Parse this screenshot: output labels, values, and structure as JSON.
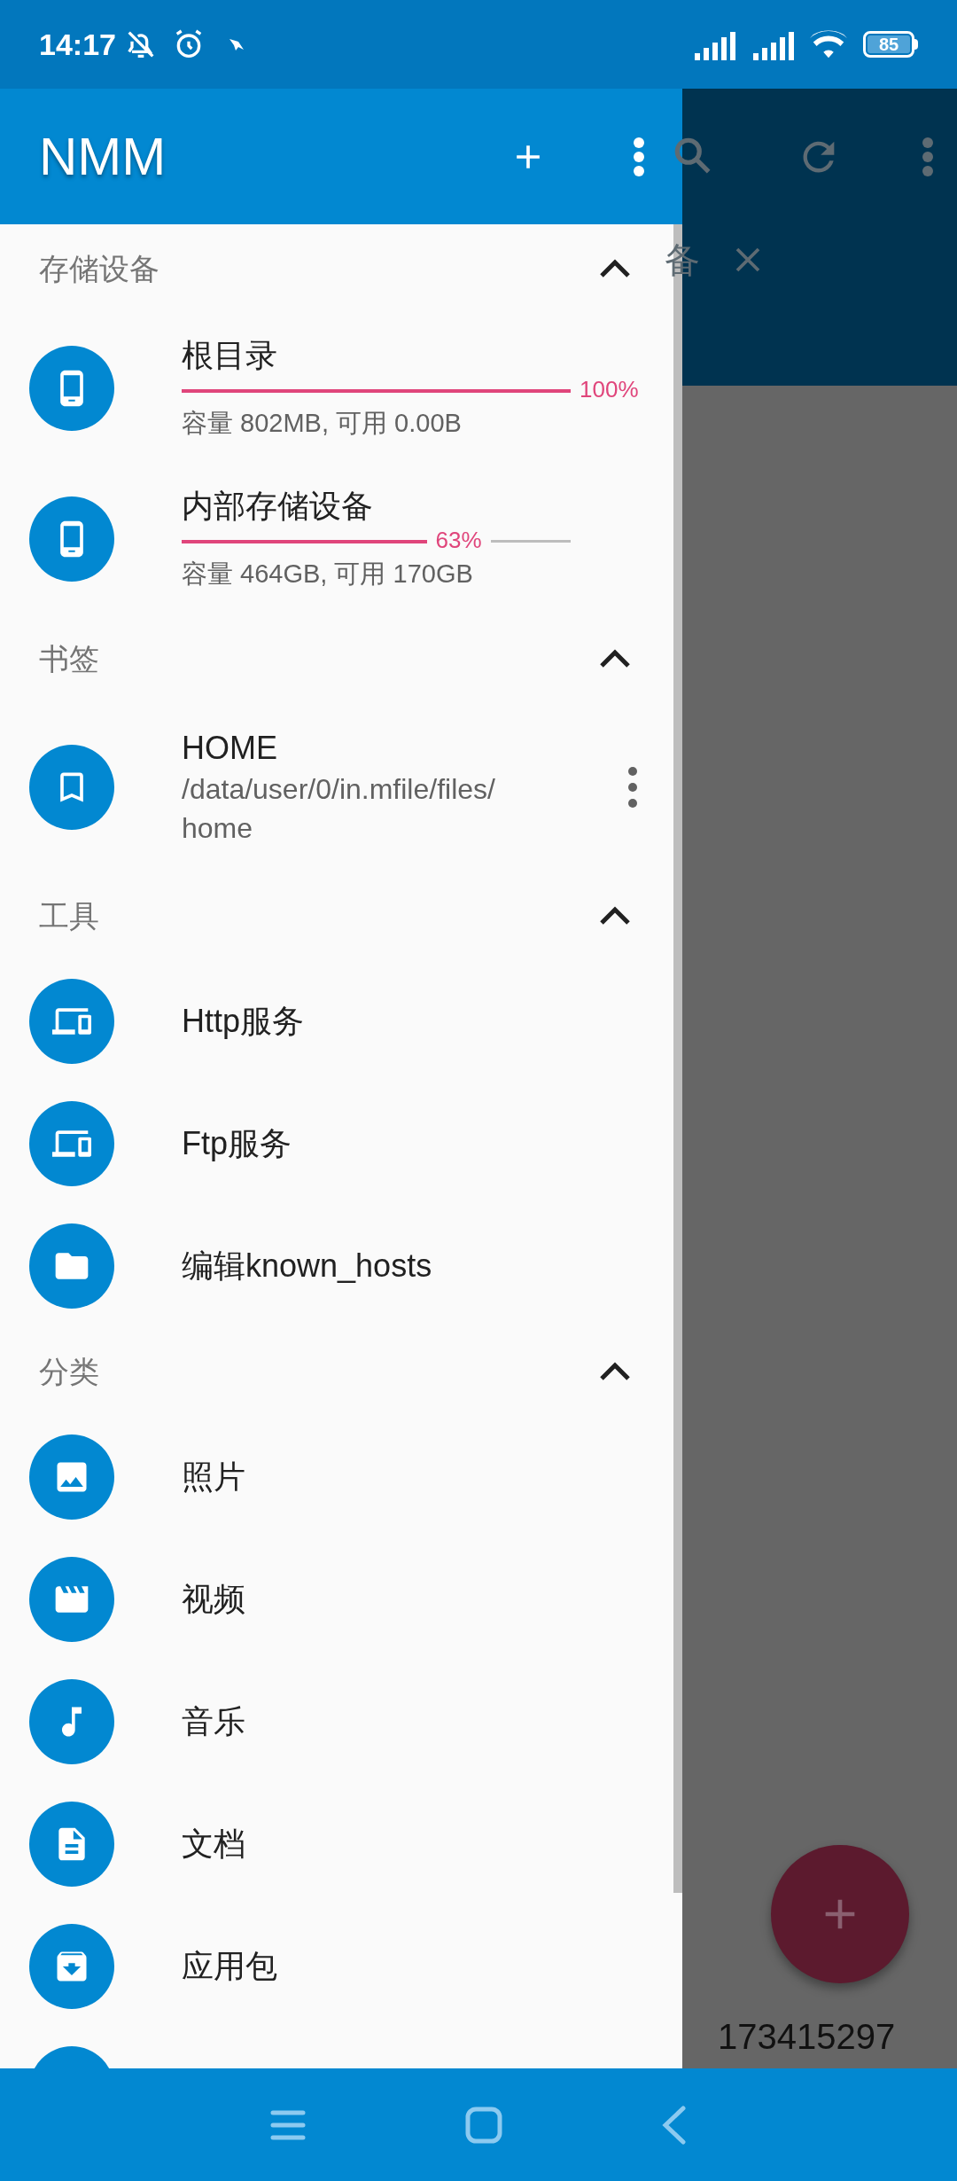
{
  "status_bar": {
    "time": "14:17",
    "battery": "85"
  },
  "background": {
    "tab_label": "备",
    "file_name": "173415297"
  },
  "drawer": {
    "title": "NMM",
    "sections": [
      {
        "title": "存储设备",
        "expanded": true,
        "items": [
          {
            "kind": "storage",
            "name": "根目录",
            "level": 1.0,
            "percent": "100%",
            "detail": "容量 802MB, 可用 0.00B"
          },
          {
            "kind": "storage",
            "name": "内部存储设备",
            "level": 0.63,
            "percent": "63%",
            "detail": "容量 464GB, 可用 170GB"
          }
        ]
      },
      {
        "title": "书签",
        "expanded": true,
        "items": [
          {
            "kind": "bookmark",
            "name": "HOME",
            "path": "/data/user/0/in.mfile/files/home"
          }
        ]
      },
      {
        "title": "工具",
        "expanded": true,
        "items": [
          {
            "kind": "entry",
            "name": "Http服务"
          },
          {
            "kind": "entry",
            "name": "Ftp服务"
          },
          {
            "kind": "entry",
            "name": "编辑known_hosts"
          }
        ]
      },
      {
        "title": "分类",
        "expanded": true,
        "items": [
          {
            "kind": "entry",
            "name": "照片"
          },
          {
            "kind": "entry",
            "name": "视频"
          },
          {
            "kind": "entry",
            "name": "音乐"
          },
          {
            "kind": "entry",
            "name": "文档"
          },
          {
            "kind": "entry",
            "name": "应用包"
          },
          {
            "kind": "cut"
          }
        ]
      }
    ]
  }
}
